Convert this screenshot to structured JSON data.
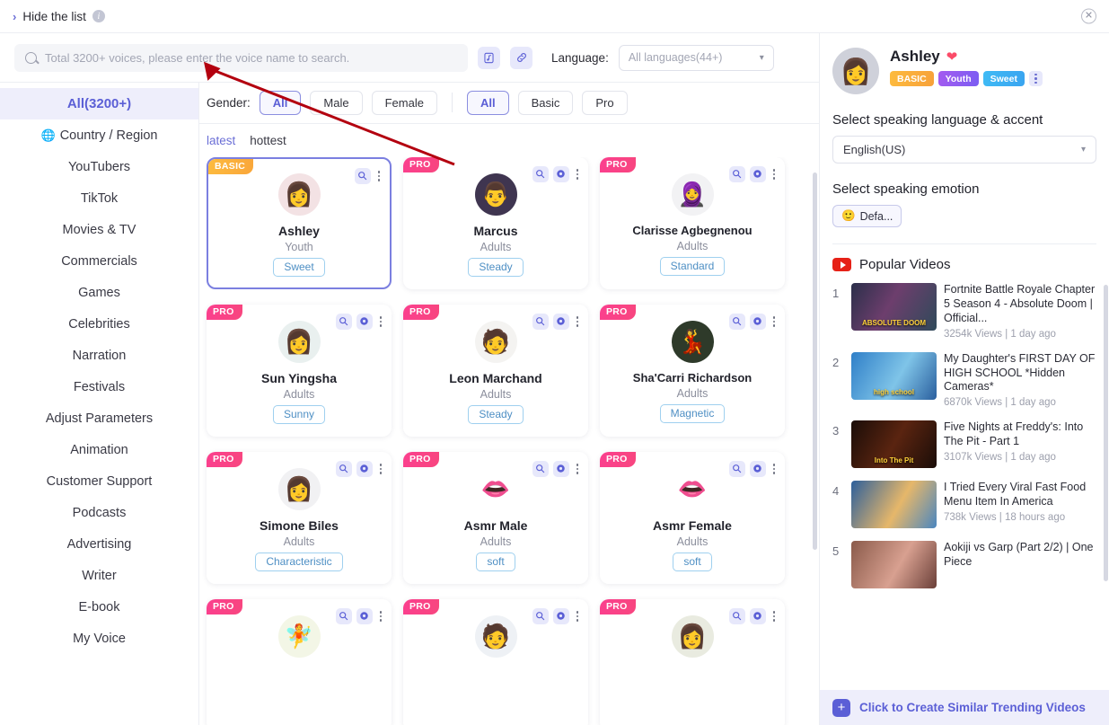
{
  "topbar": {
    "hide_list_label": "Hide the list",
    "chevron": "›",
    "info_icon": "i",
    "close_icon": "✕"
  },
  "search": {
    "placeholder": "Total 3200+ voices, please enter the voice name to search.",
    "value": "",
    "upload_icon": "music-file-icon",
    "link_icon": "link-icon"
  },
  "language": {
    "label": "Language:",
    "selected": "All languages(44+)",
    "caret": "⌄"
  },
  "categories": [
    {
      "label": "All(3200+)",
      "active": true
    },
    {
      "label": "Country / Region",
      "icon": "🌐",
      "active": false
    },
    {
      "label": "YouTubers",
      "active": false
    },
    {
      "label": "TikTok",
      "active": false
    },
    {
      "label": "Movies & TV",
      "active": false
    },
    {
      "label": "Commercials",
      "active": false
    },
    {
      "label": "Games",
      "active": false
    },
    {
      "label": "Celebrities",
      "active": false
    },
    {
      "label": "Narration",
      "active": false
    },
    {
      "label": "Festivals",
      "active": false
    },
    {
      "label": "Adjust Parameters",
      "active": false
    },
    {
      "label": "Animation",
      "active": false
    },
    {
      "label": "Customer Support",
      "active": false
    },
    {
      "label": "Podcasts",
      "active": false
    },
    {
      "label": "Advertising",
      "active": false
    },
    {
      "label": "Writer",
      "active": false
    },
    {
      "label": "E-book",
      "active": false
    },
    {
      "label": "My Voice",
      "active": false
    }
  ],
  "filters": {
    "gender_label": "Gender:",
    "gender_options": [
      {
        "label": "All",
        "selected": true
      },
      {
        "label": "Male",
        "selected": false
      },
      {
        "label": "Female",
        "selected": false
      }
    ],
    "tier_options": [
      {
        "label": "All",
        "selected": true
      },
      {
        "label": "Basic",
        "selected": false
      },
      {
        "label": "Pro",
        "selected": false
      }
    ]
  },
  "sort": [
    {
      "label": "latest",
      "active": true
    },
    {
      "label": "hottest",
      "active": false
    }
  ],
  "voices": [
    {
      "badge": "BASIC",
      "name": "Ashley",
      "age": "Youth",
      "style": "Sweet",
      "selected": true,
      "has_gear": false,
      "avatar": "👩",
      "avatar_bg": "#f3e2e4"
    },
    {
      "badge": "PRO",
      "name": "Marcus",
      "age": "Adults",
      "style": "Steady",
      "selected": false,
      "has_gear": true,
      "avatar": "👨",
      "avatar_bg": "#3f3550"
    },
    {
      "badge": "PRO",
      "name": "Clarisse Agbegnenou",
      "age": "Adults",
      "style": "Standard",
      "selected": false,
      "has_gear": true,
      "avatar": "🧕",
      "avatar_bg": "#f2f2f4"
    },
    {
      "badge": "PRO",
      "name": "Sun Yingsha",
      "age": "Adults",
      "style": "Sunny",
      "selected": false,
      "has_gear": true,
      "avatar": "👩",
      "avatar_bg": "#e9f0ef"
    },
    {
      "badge": "PRO",
      "name": "Leon Marchand",
      "age": "Adults",
      "style": "Steady",
      "selected": false,
      "has_gear": true,
      "avatar": "🧑",
      "avatar_bg": "#f4f3f1"
    },
    {
      "badge": "PRO",
      "name": "Sha'Carri Richardson",
      "age": "Adults",
      "style": "Magnetic",
      "selected": false,
      "has_gear": true,
      "avatar": "💃",
      "avatar_bg": "#2e3a2a"
    },
    {
      "badge": "PRO",
      "name": "Simone Biles",
      "age": "Adults",
      "style": "Characteristic",
      "selected": false,
      "has_gear": true,
      "avatar": "👩",
      "avatar_bg": "#f1f1f3"
    },
    {
      "badge": "PRO",
      "name": "Asmr Male",
      "age": "Adults",
      "style": "soft",
      "selected": false,
      "has_gear": true,
      "avatar": "👄",
      "avatar_bg": "#ffffff"
    },
    {
      "badge": "PRO",
      "name": "Asmr Female",
      "age": "Adults",
      "style": "soft",
      "selected": false,
      "has_gear": true,
      "avatar": "👄",
      "avatar_bg": "#ffffff"
    },
    {
      "badge": "PRO",
      "name": "",
      "age": "",
      "style": "",
      "selected": false,
      "has_gear": true,
      "avatar": "🧚",
      "avatar_bg": "#f3f6e6"
    },
    {
      "badge": "PRO",
      "name": "",
      "age": "",
      "style": "",
      "selected": false,
      "has_gear": true,
      "avatar": "🧑",
      "avatar_bg": "#eef1f5"
    },
    {
      "badge": "PRO",
      "name": "",
      "age": "",
      "style": "",
      "selected": false,
      "has_gear": true,
      "avatar": "👩",
      "avatar_bg": "#e9ebe0"
    }
  ],
  "profile": {
    "name": "Ashley",
    "heart": "❤",
    "avatar": "👩",
    "tags": [
      {
        "label": "BASIC",
        "kind": "basic"
      },
      {
        "label": "Youth",
        "kind": "youth"
      },
      {
        "label": "Sweet",
        "kind": "sweet"
      }
    ]
  },
  "panel": {
    "language_title": "Select speaking language & accent",
    "language_value": "English(US)",
    "emotion_title": "Select speaking emotion",
    "emotion_value": "Defa...",
    "emotion_emoji": "🙂",
    "videos_title": "Popular Videos",
    "create_label": "Click to Create Similar Trending Videos",
    "create_icon": "+"
  },
  "popular_videos": [
    {
      "rank": "1",
      "title": "Fortnite Battle Royale Chapter 5 Season 4 - Absolute Doom | Official...",
      "meta": "3254k Views | 1 day ago",
      "thumb_text": "ABSOLUTE DOOM",
      "thumb_bg": "linear-gradient(120deg,#2b2f4a,#6d3e6d 45%,#2f4a5a)"
    },
    {
      "rank": "2",
      "title": "My Daughter's FIRST DAY OF HIGH SCHOOL *Hidden Cameras*",
      "meta": "6870k Views | 1 day ago",
      "thumb_text": "high school",
      "thumb_bg": "linear-gradient(120deg,#2f7fc8,#7fc4e8 55%,#2a5f9e)"
    },
    {
      "rank": "3",
      "title": "Five Nights at Freddy's: Into The Pit - Part 1",
      "meta": "3107k Views | 1 day ago",
      "thumb_text": "Into The Pit",
      "thumb_bg": "linear-gradient(120deg,#1a0d08,#5a2410 50%,#1a0d08)"
    },
    {
      "rank": "4",
      "title": "I Tried Every Viral Fast Food Menu Item In America",
      "meta": "738k Views | 18 hours ago",
      "thumb_text": "",
      "thumb_bg": "linear-gradient(120deg,#2d5f9b,#e6b76a 55%,#4a86c0)"
    },
    {
      "rank": "5",
      "title": "Aokiji vs Garp (Part 2/2) | One Piece",
      "meta": "",
      "thumb_text": "",
      "thumb_bg": "linear-gradient(120deg,#8a5a4a,#d8a090 55%,#6a3f38)"
    }
  ],
  "colors": {
    "accent": "#5b5fd6",
    "pro": "#fb3f8e",
    "basic": "#fdbb3e",
    "annotation": "#b3000f"
  }
}
